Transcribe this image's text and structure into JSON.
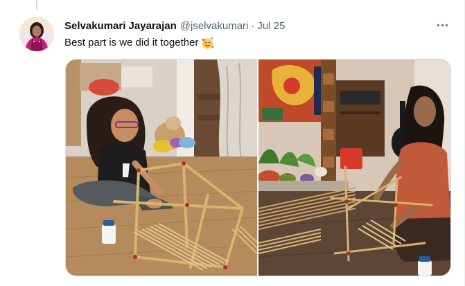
{
  "tweet": {
    "author_name": "Selvakumari Jayarajan",
    "handle": "@jselvakumari",
    "separator": "·",
    "date": "Jul 25",
    "text": "Best part is we did it together",
    "emoji": "smiling-face-with-hearts"
  },
  "media": {
    "photos": [
      {
        "subject": "girl-building-bamboo-stick-structure"
      },
      {
        "subject": "woman-building-bamboo-stick-structure"
      }
    ]
  },
  "colors": {
    "text_primary": "#0f1419",
    "text_secondary": "#536471",
    "border": "#cfd9de"
  },
  "icons": {
    "more": "more-horizontal-icon",
    "emoji": "smiling-face-with-hearts-emoji"
  }
}
